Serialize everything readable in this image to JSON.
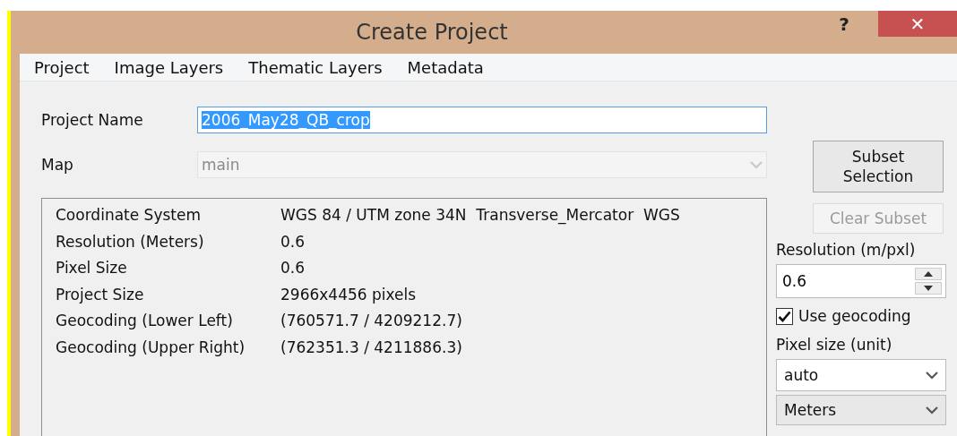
{
  "window": {
    "title": "Create Project",
    "help_button": "?",
    "close_button": "✕"
  },
  "menu": [
    "Project",
    "Image Layers",
    "Thematic Layers",
    "Metadata"
  ],
  "project_name": {
    "label": "Project Name",
    "value": "2006_May28_QB_crop",
    "selected": true
  },
  "map": {
    "label": "Map",
    "value": "main",
    "disabled": true
  },
  "info": [
    {
      "name": "Coordinate System",
      "value": "WGS 84 / UTM zone 34N  Transverse_Mercator  WGS"
    },
    {
      "name": "Resolution (Meters)",
      "value": "0.6"
    },
    {
      "name": "Pixel Size",
      "value": "0.6"
    },
    {
      "name": "Project Size",
      "value": "2966x4456 pixels"
    },
    {
      "name": "Geocoding (Lower Left)",
      "value": "(760571.7 / 4209212.7)"
    },
    {
      "name": "Geocoding (Upper Right)",
      "value": "(762351.3 / 4211886.3)"
    }
  ],
  "subset_selection": {
    "label": "Subset Selection",
    "disabled": false
  },
  "clear_subset": {
    "label": "Clear Subset",
    "disabled": true
  },
  "resolution": {
    "label": "Resolution (m/pxl)",
    "value": "0.6"
  },
  "use_geocoding": {
    "label": "Use geocoding",
    "checked": true
  },
  "pixel_size": {
    "label": "Pixel size (unit)",
    "value": "auto",
    "unit": "Meters"
  }
}
